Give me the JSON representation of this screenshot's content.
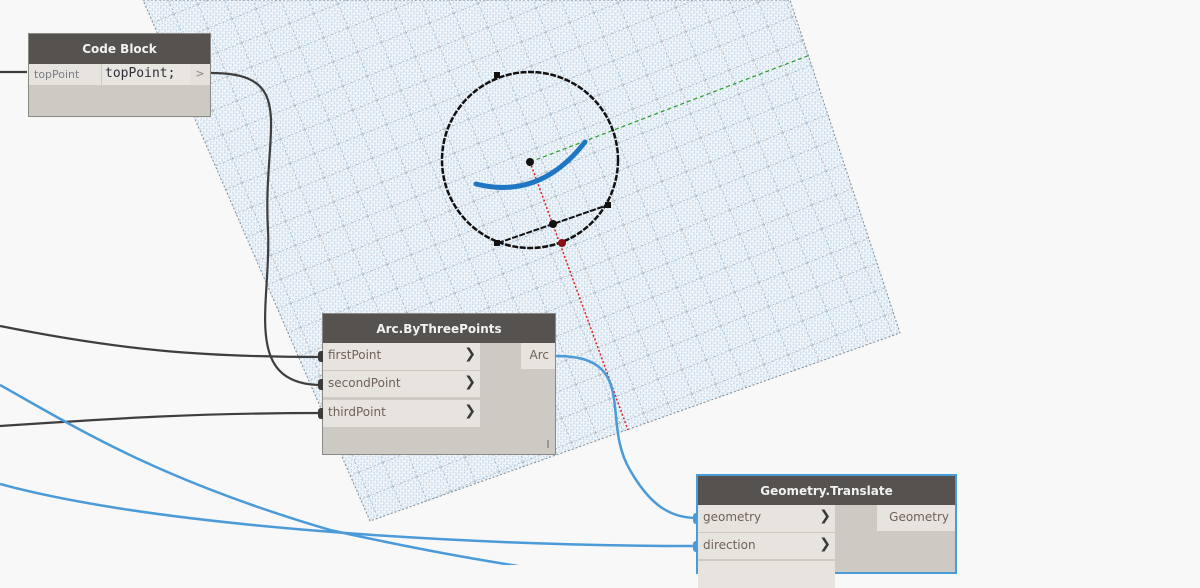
{
  "canvas": {
    "background_color": "#f8f8f8",
    "grid_color": "#b9d3e6",
    "grid_line_color": "#7c8a94",
    "axis_x_color": "#e02020",
    "axis_y_color": "#2a9a2a",
    "preview_arc_color": "#1f77c4",
    "preview_geometry_color": "#111111"
  },
  "wires": {
    "dark_color": "#3e3e3e",
    "selected_color": "#4a9bd8"
  },
  "nodes": {
    "code_block": {
      "title": "Code Block",
      "input_label": "topPoint",
      "code": "topPoint;",
      "output_glyph": ">"
    },
    "arc_by_three_points": {
      "title": "Arc.ByThreePoints",
      "inputs": [
        {
          "label": "firstPoint",
          "chevron": "❯"
        },
        {
          "label": "secondPoint",
          "chevron": "❯"
        },
        {
          "label": "thirdPoint",
          "chevron": "❯"
        }
      ],
      "output_label": "Arc"
    },
    "geometry_translate": {
      "title": "Geometry.Translate",
      "selected": true,
      "inputs": [
        {
          "label": "geometry",
          "chevron": "❯"
        },
        {
          "label": "direction",
          "chevron": "❯"
        }
      ],
      "output_label": "Geometry"
    }
  }
}
